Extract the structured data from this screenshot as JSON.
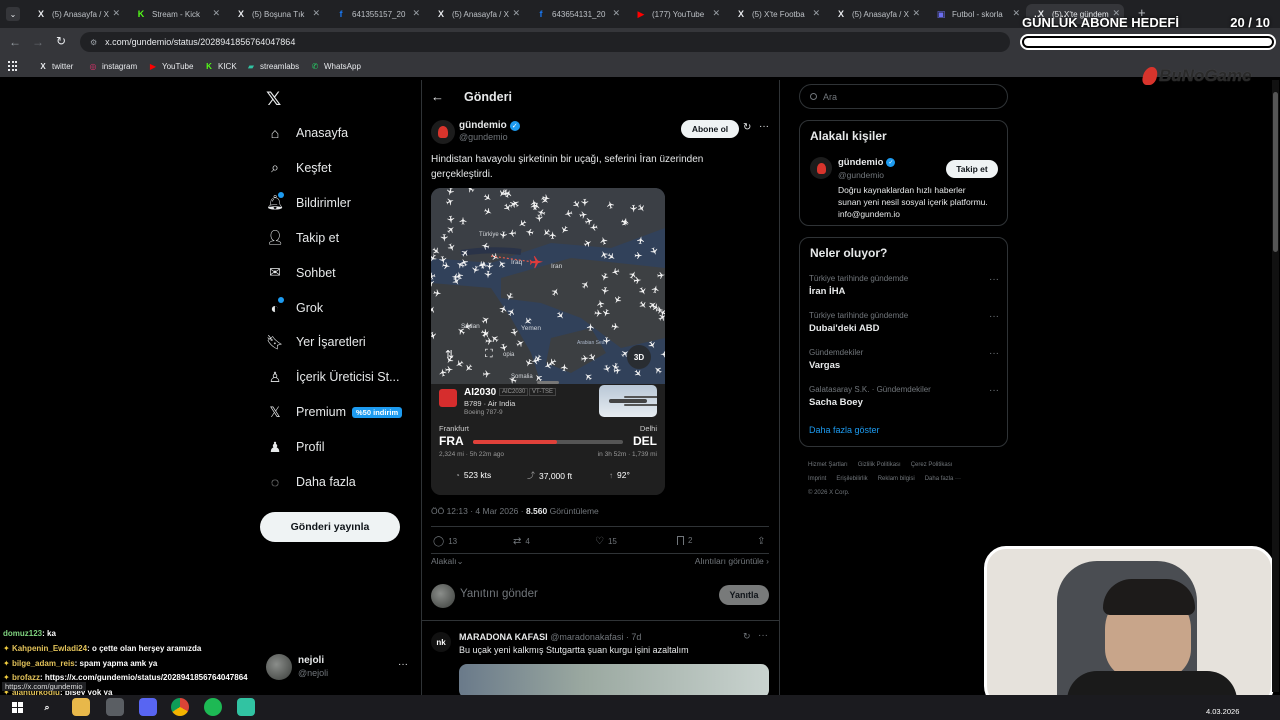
{
  "browser": {
    "tabs": [
      {
        "label": "(5) Anasayfa / X",
        "icon": "x-icon"
      },
      {
        "label": "Stream - Kick",
        "icon": "kick-icon"
      },
      {
        "label": "(5) Boşuna Tık",
        "icon": "x-icon"
      },
      {
        "label": "641355157_20",
        "icon": "facebook-icon"
      },
      {
        "label": "(5) Anasayfa / X",
        "icon": "x-icon"
      },
      {
        "label": "643654131_20",
        "icon": "facebook-icon"
      },
      {
        "label": "(177) YouTube",
        "icon": "youtube-icon"
      },
      {
        "label": "(5) X'te Footba",
        "icon": "x-icon"
      },
      {
        "label": "(5) Anasayfa / X",
        "icon": "x-icon"
      },
      {
        "label": "Futbol - skorla",
        "icon": "generic-icon"
      },
      {
        "label": "(5) X'te gündem",
        "icon": "x-icon"
      }
    ],
    "url": "x.com/gundemio/status/2028941856764047864",
    "bookmarks": [
      {
        "label": "twitter",
        "icon": "x-icon"
      },
      {
        "label": "instagram",
        "icon": "instagram-icon"
      },
      {
        "label": "YouTube",
        "icon": "youtube-icon"
      },
      {
        "label": "KICK",
        "icon": "kick-icon"
      },
      {
        "label": "streamlabs",
        "icon": "streamlabs-icon"
      },
      {
        "label": "WhatsApp",
        "icon": "whatsapp-icon"
      }
    ],
    "status_url": "https://x.com/gundemio"
  },
  "overlay": {
    "goal_label": "GÜNLÜK ABONE HEDEFİ",
    "goal_count": "20 / 10",
    "goal_progress": 1.0,
    "logo_text": "BuNoGame"
  },
  "nav": {
    "items": [
      "Anasayfa",
      "Keşfet",
      "Bildirimler",
      "Takip et",
      "Sohbet",
      "Grok",
      "Yer İşaretleri",
      "İçerik Üreticisi St...",
      "Premium",
      "Profil",
      "Daha fazla"
    ],
    "premium_badge": "%50 indirim",
    "post_button": "Gönderi yayınla",
    "user_name": "nejoli",
    "user_handle": "@nejoli"
  },
  "post": {
    "header": "Gönderi",
    "author": "gündemio",
    "handle": "@gundemio",
    "follow_label": "Abone ol",
    "text": "Hindistan havayolu şirketinin bir uçağı, seferini İran üzerinden gerçekleştirdi.",
    "map_labels": {
      "turkey": "Türkiye",
      "iraq": "Iraq",
      "iran": "Iran",
      "sudan": "Sudan",
      "yemen": "Yemen",
      "arabian_sea": "Arabian Sea",
      "ethiopia": "opia",
      "somalia": "Somalia",
      "view3d": "3D"
    },
    "flight": {
      "number": "AI2030",
      "callsign": "AIC2030",
      "reg": "VT-TSE",
      "aircraft": "B789 · Air India",
      "model": "Boeing 787-9",
      "from_city": "Frankfurt",
      "from_code": "FRA",
      "to_city": "Delhi",
      "to_code": "DEL",
      "left_stat": "2,324 mi · 5h 22m ago",
      "right_stat": "in 3h 52m · 1,739 mi",
      "progress": 0.56,
      "speed": "523 kts",
      "altitude": "37,000 ft",
      "heading": "92°"
    },
    "meta_time": "ÖÖ 12:13 · 4 Mar 2026 · ",
    "views_count": "8.560",
    "views_label": " Görüntüleme",
    "replies": "13",
    "reposts": "4",
    "likes": "15",
    "bookmarks": "2",
    "relevant": "Alakalı",
    "quotes": "Alıntıları görüntüle",
    "reply_placeholder": "Yanıtını gönder",
    "reply_button": "Yanıtla"
  },
  "reply": {
    "author": "MARADONA KAFASI",
    "handle": "@maradonakafasi · 7d",
    "text": "Bu uçak yeni kalkmış Stutgartta şuan kurgu işini azaltalım"
  },
  "sidebar": {
    "search_placeholder": "Ara",
    "related_title": "Alakalı kişiler",
    "related_name": "gündemio",
    "related_handle": "@gundemio",
    "related_bio": "Doğru kaynaklardan hızlı haberler sunan yeni nesil sosyal içerik platformu. info@gundem.io",
    "follow_label": "Takip et",
    "trends_title": "Neler oluyor?",
    "trends": [
      {
        "category": "Türkiye tarihinde gündemde",
        "title": "İran İHA"
      },
      {
        "category": "Türkiye tarihinde gündemde",
        "title": "Dubai'deki ABD"
      },
      {
        "category": "Gündemdekiler",
        "title": "Vargas"
      },
      {
        "category": "Galatasaray S.K. · Gündemdekiler",
        "title": "Sacha Boey"
      }
    ],
    "show_more": "Daha fazla göster",
    "footer_line1": [
      "Hizmet Şartları",
      "Gizlilik Politikası",
      "Çerez Politikası"
    ],
    "footer_line2": [
      "Imprint",
      "Erişilebilirlik",
      "Reklam bilgisi",
      "Daha fazla ···"
    ],
    "footer_copy": "© 2026 X Corp."
  },
  "chat": [
    {
      "user": "domuz123",
      "text": ": ka",
      "color": "#7fd37f"
    },
    {
      "user": "Kahpenin_Ewladi24",
      "text": ": o çette olan herşey aramızda",
      "color": "#e3c35a"
    },
    {
      "user": "bilge_adam_reis",
      "text": ": spam yapma amk ya",
      "color": "#e3c35a"
    },
    {
      "user": "brofazz",
      "text": ": https://x.com/gundemio/status/2028941856764047864",
      "color": "#e3c35a"
    },
    {
      "user": "alanturkoglu",
      "text": ": bişey yok ya",
      "color": "#e3c35a"
    }
  ],
  "taskbar": {
    "date": "4.03.2026"
  },
  "colors": {
    "x_blue": "#1d9bf0",
    "air_india_red": "#d62d2d",
    "background": "#000000"
  }
}
